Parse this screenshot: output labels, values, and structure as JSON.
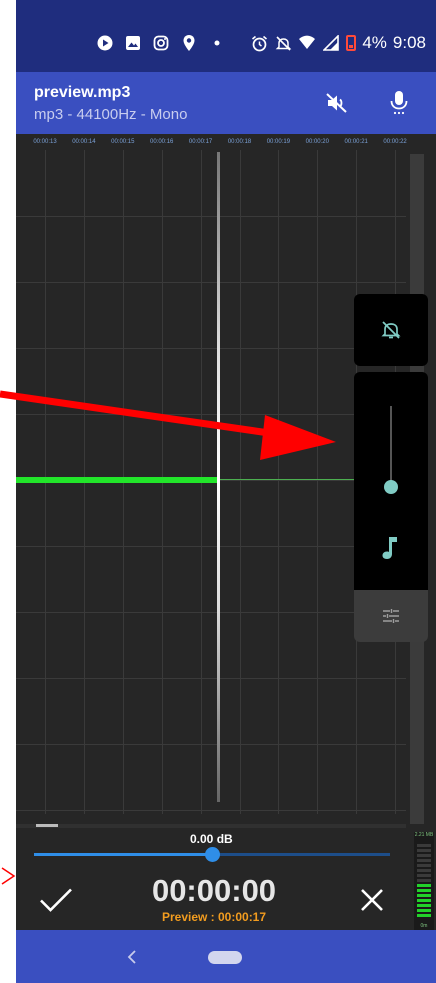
{
  "status_bar": {
    "battery": "4%",
    "time": "9:08",
    "icons": [
      "play-icon",
      "gallery-icon",
      "instagram-icon",
      "location-icon",
      "dot-icon",
      "alarm-icon",
      "mute-icon",
      "wifi-icon",
      "signal-icon",
      "battery-icon"
    ]
  },
  "app_bar": {
    "file_name": "preview.mp3",
    "file_info": "mp3 - 44100Hz - Mono",
    "actions": [
      "volume-off-icon",
      "microphone-icon"
    ]
  },
  "timeline": {
    "labels": [
      "00:00:13",
      "00:00:14",
      "00:00:15",
      "00:00:16",
      "00:00:17",
      "00:00:18",
      "00:00:19",
      "00:00:20",
      "00:00:21",
      "00:00:22"
    ]
  },
  "volume_panel": {
    "level": 0.1,
    "icons": [
      "bell-off-icon",
      "music-note-icon",
      "equalizer-settings-icon"
    ]
  },
  "bottom": {
    "gain_label": "0.00 dB",
    "gain_position": 0.5,
    "timer": "00:00:00",
    "preview_label": "Preview : 00:00:17",
    "confirm_icon": "check-icon",
    "cancel_icon": "close-icon"
  },
  "meter": {
    "top_label": "2.21 MB",
    "bottom_label": "0m",
    "lit_fraction": 0.45
  },
  "colors": {
    "status_bar": "#1f2d7e",
    "app_bar": "#3a4fc0",
    "background": "#262626",
    "waveform": "#22e52a",
    "accent_blue": "#2f8ee8",
    "preview_orange": "#f29c1f",
    "annotation_red": "#ff0000"
  }
}
